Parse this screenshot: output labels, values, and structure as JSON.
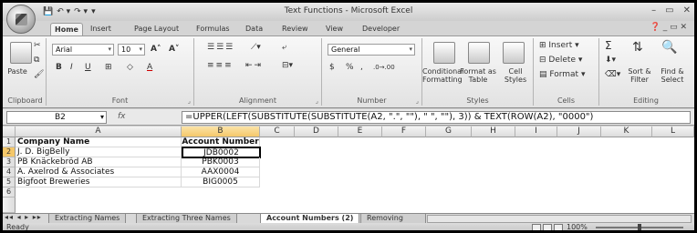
{
  "window": {
    "title": "Text Functions - Microsoft Excel",
    "min": "–",
    "max": "▭",
    "close": "✕"
  },
  "qat": {
    "save": "💾",
    "undo": "↶ ▾",
    "redo": "↷ ▾",
    "more": "▾"
  },
  "tabs": [
    "Home",
    "Insert",
    "Page Layout",
    "Formulas",
    "Data",
    "Review",
    "View",
    "Developer"
  ],
  "help": "❓ _ ▭ ✕",
  "ribbon": {
    "clipboard": {
      "paste": "Paste",
      "label": "Clipboard"
    },
    "font": {
      "name": "Arial",
      "size": "10",
      "grow": "A˄",
      "shrink": "A˅",
      "bold": "B",
      "italic": "I",
      "underline": "U",
      "border": "⊞",
      "fill": "◇",
      "color": "A",
      "label": "Font"
    },
    "alignment": {
      "label": "Alignment"
    },
    "number": {
      "format": "General",
      "currency": "$",
      "percent": "%",
      "comma": ",",
      "inc": ".0→.00",
      "dec": ".00→.0",
      "label": "Number"
    },
    "styles": {
      "conditional": "Conditional Formatting",
      "format_table": "Format as Table",
      "cell_styles": "Cell Styles",
      "label": "Styles"
    },
    "cells": {
      "insert": "Insert",
      "delete": "Delete",
      "format": "Format",
      "label": "Cells"
    },
    "editing": {
      "sum": "Σ",
      "sort": "Sort & Filter",
      "find": "Find & Select",
      "label": "Editing"
    }
  },
  "formula_bar": {
    "name_box": "B2",
    "fx": "fx",
    "formula": "=UPPER(LEFT(SUBSTITUTE(SUBSTITUTE(A2, \".\", \"\"), \" \", \"\"), 3)) & TEXT(ROW(A2), \"0000\")"
  },
  "columns": [
    "A",
    "B",
    "C",
    "D",
    "E",
    "F",
    "G",
    "H",
    "I",
    "J",
    "K",
    "L"
  ],
  "rows": [
    "1",
    "2",
    "3",
    "4",
    "5",
    "6"
  ],
  "cells": {
    "A1": "Company Name",
    "B1": "Account Number",
    "A2": "J. D. BigBelly",
    "B2": "JDB0002",
    "A3": "PB Knäckebröd AB",
    "B3": "PBK0003",
    "A4": "A. Axelrod & Associates",
    "B4": "AAX0004",
    "A5": "Bigfoot Breweries",
    "B5": "BIG0005"
  },
  "sheet_tabs": [
    "Extracting Names",
    "Extracting Three Names",
    "Account Numbers (2)",
    "Removing Line"
  ],
  "active_sheet": "Account Numbers (2)",
  "status": {
    "ready": "Ready",
    "zoom": "100%"
  }
}
